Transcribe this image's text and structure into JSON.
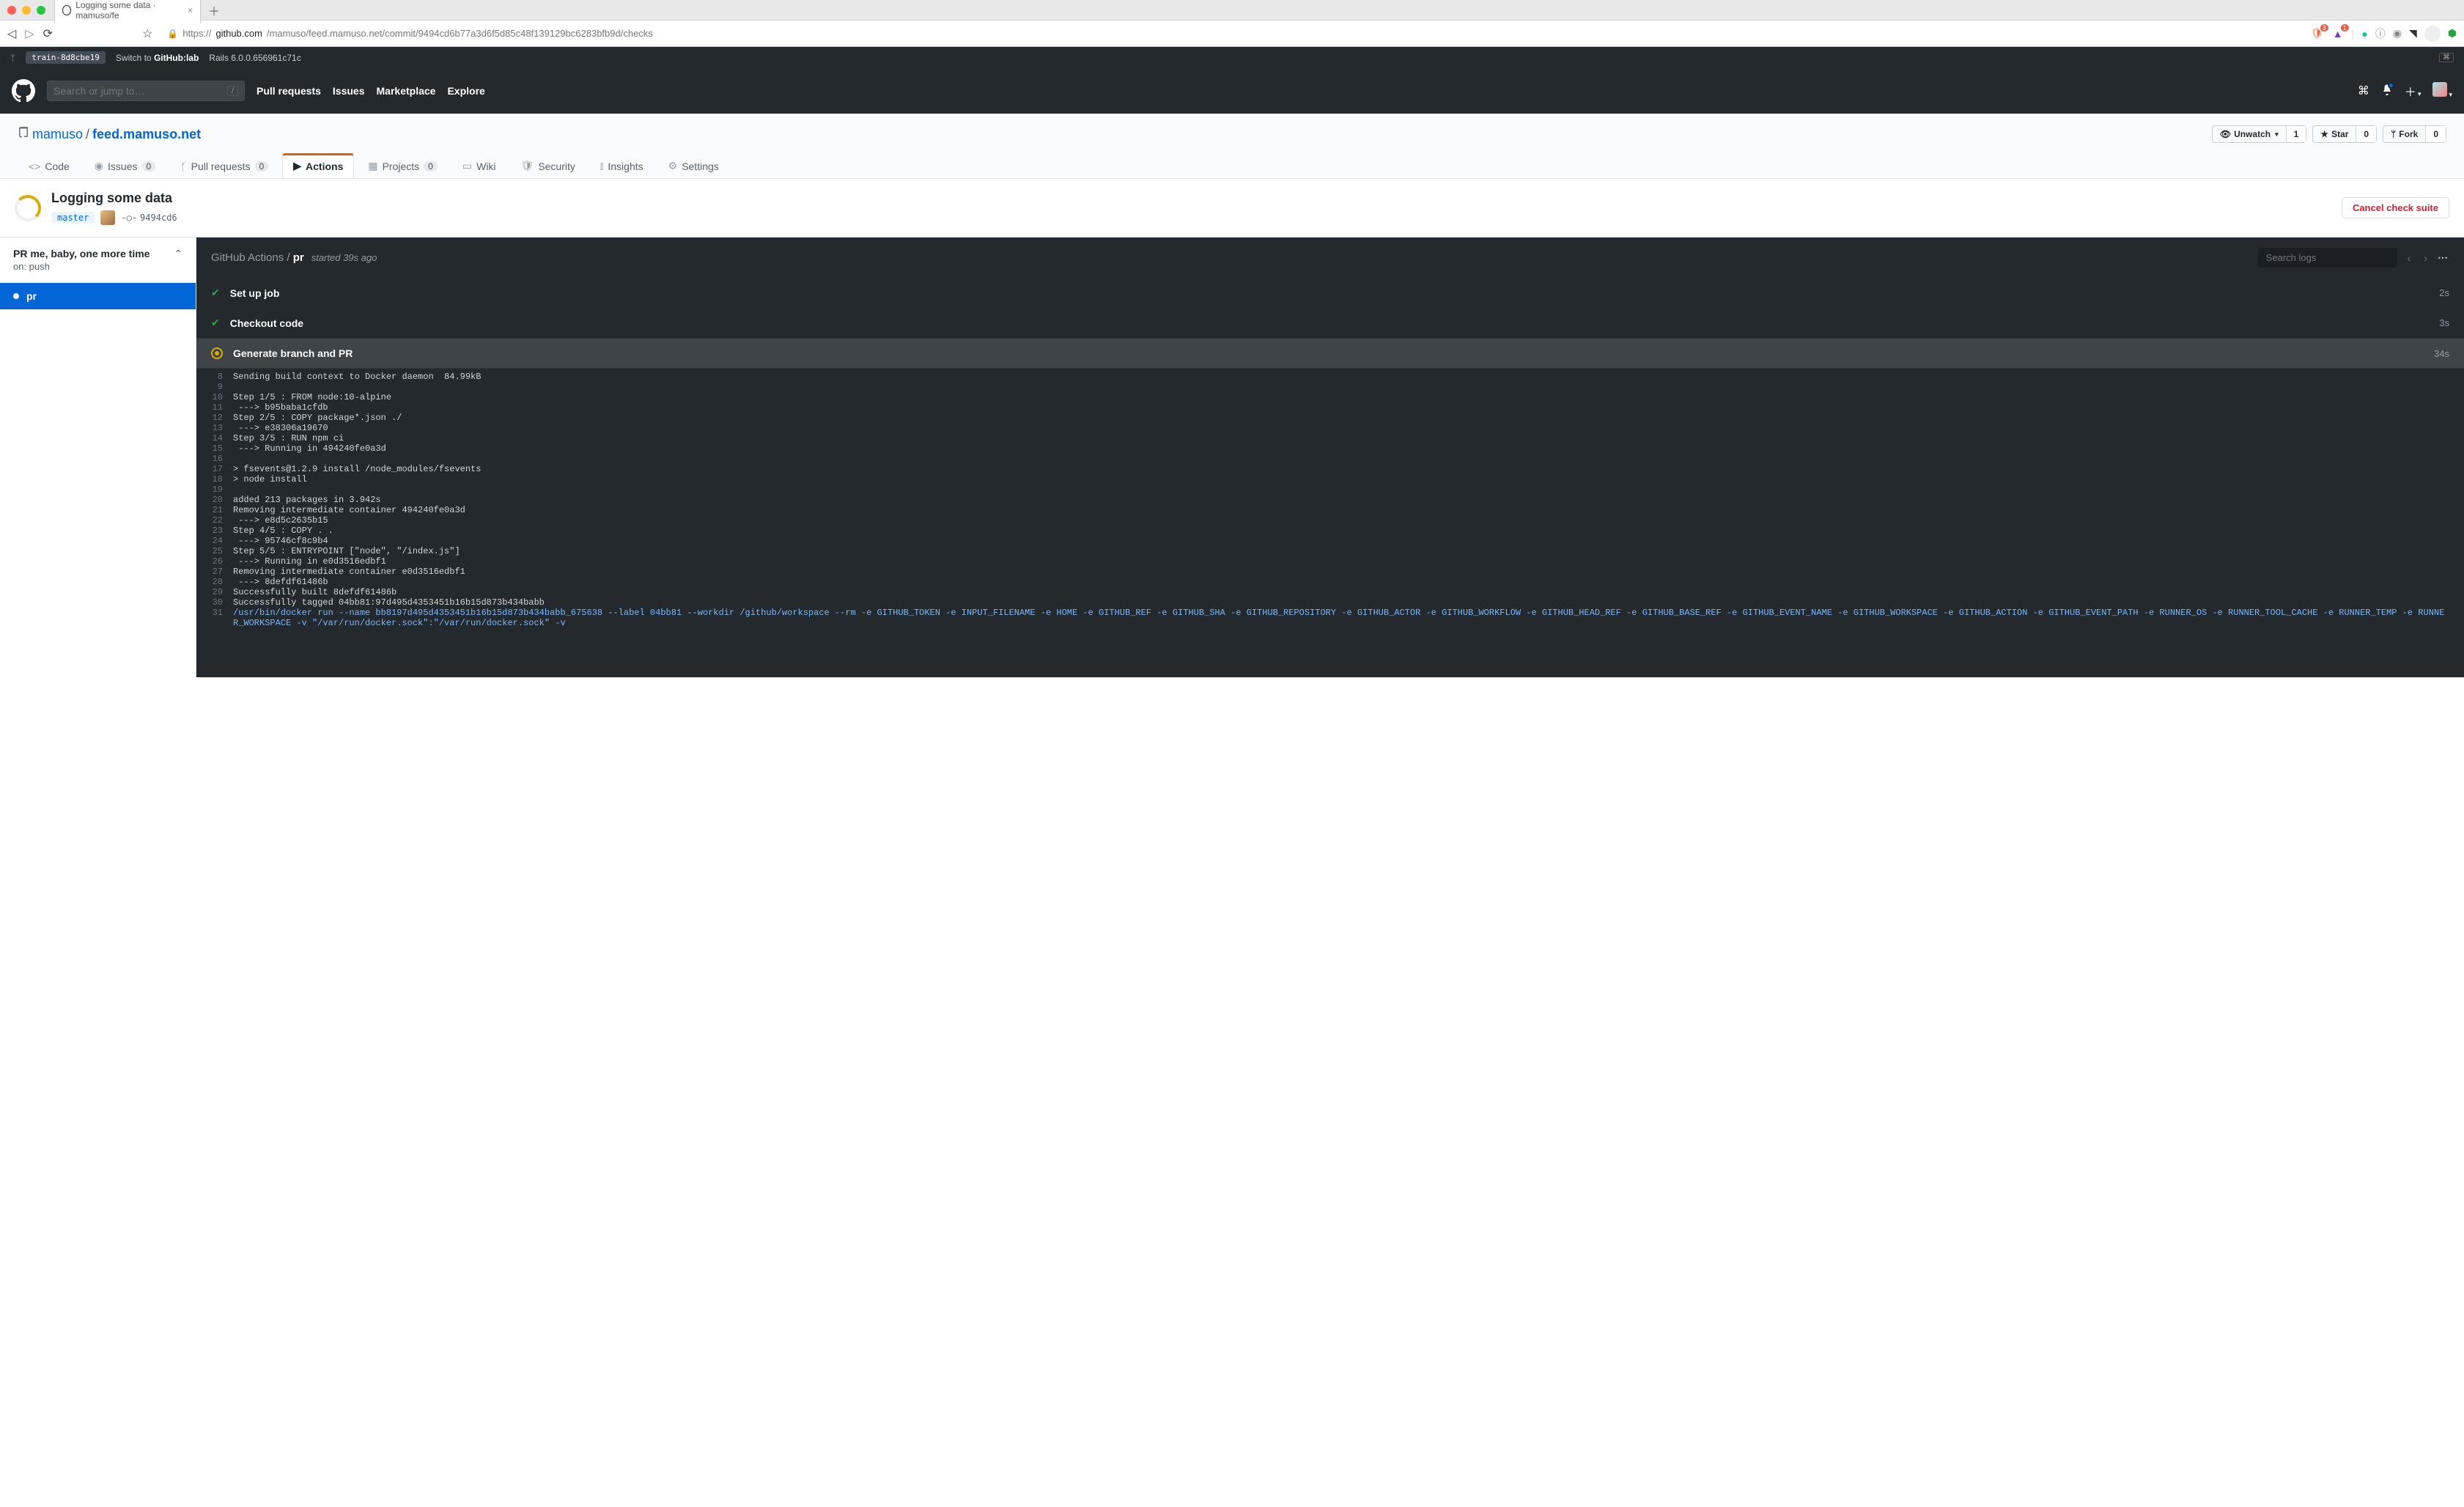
{
  "browser": {
    "tab_title": "Logging some data · mamuso/fe",
    "url_proto": "https://",
    "url_host": "github.com",
    "url_path": "/mamuso/feed.mamuso.net/commit/9494cd6b77a3d6f5d85c48f139129bc6283bfb9d/checks",
    "ext_badge1": "3",
    "ext_badge2": "1"
  },
  "devstrip": {
    "branch": "train-8d8cbe19",
    "switch_prefix": "Switch to ",
    "switch_target": "GitHub:lab",
    "rails": "Rails 6.0.0.656961c71c"
  },
  "gh_header": {
    "search_placeholder": "Search or jump to…",
    "slash": "/",
    "nav": {
      "pulls": "Pull requests",
      "issues": "Issues",
      "marketplace": "Marketplace",
      "explore": "Explore"
    }
  },
  "repo": {
    "owner": "mamuso",
    "name": "feed.mamuso.net",
    "sep": "/",
    "actions": {
      "unwatch": "Unwatch",
      "unwatch_count": "1",
      "star": "Star",
      "star_count": "0",
      "fork": "Fork",
      "fork_count": "0"
    },
    "nav": {
      "code": "Code",
      "issues": "Issues",
      "issues_count": "0",
      "pulls": "Pull requests",
      "pulls_count": "0",
      "actions": "Actions",
      "projects": "Projects",
      "projects_count": "0",
      "wiki": "Wiki",
      "security": "Security",
      "insights": "Insights",
      "settings": "Settings"
    }
  },
  "checks": {
    "title": "Logging some data",
    "branch": "master",
    "sha": "9494cd6",
    "cancel": "Cancel check suite",
    "workflow": "PR me, baby, one more time",
    "on_label": "on: push",
    "job_name": "pr",
    "crumb_prefix": "GitHub Actions / ",
    "crumb_job": "pr",
    "started": "started 39s ago",
    "search_placeholder": "Search logs"
  },
  "steps": {
    "s1": {
      "name": "Set up job",
      "dur": "2s"
    },
    "s2": {
      "name": "Checkout code",
      "dur": "3s"
    },
    "s3": {
      "name": "Generate branch and PR",
      "dur": "34s"
    }
  },
  "log": {
    "l8": {
      "n": "8",
      "t": "Sending build context to Docker daemon  84.99kB"
    },
    "l9": {
      "n": "9",
      "t": ""
    },
    "l10": {
      "n": "10",
      "t": "Step 1/5 : FROM node:10-alpine"
    },
    "l11": {
      "n": "11",
      "t": " ---> b95baba1cfdb"
    },
    "l12": {
      "n": "12",
      "t": "Step 2/5 : COPY package*.json ./"
    },
    "l13": {
      "n": "13",
      "t": " ---> e38306a19670"
    },
    "l14": {
      "n": "14",
      "t": "Step 3/5 : RUN npm ci"
    },
    "l15": {
      "n": "15",
      "t": " ---> Running in 494240fe0a3d"
    },
    "l16": {
      "n": "16",
      "t": ""
    },
    "l17": {
      "n": "17",
      "t": "> fsevents@1.2.9 install /node_modules/fsevents"
    },
    "l18": {
      "n": "18",
      "t": "> node install"
    },
    "l19": {
      "n": "19",
      "t": ""
    },
    "l20": {
      "n": "20",
      "t": "added 213 packages in 3.942s"
    },
    "l21": {
      "n": "21",
      "t": "Removing intermediate container 494240fe0a3d"
    },
    "l22": {
      "n": "22",
      "t": " ---> e8d5c2635b15"
    },
    "l23": {
      "n": "23",
      "t": "Step 4/5 : COPY . ."
    },
    "l24": {
      "n": "24",
      "t": " ---> 95746cf8c9b4"
    },
    "l25": {
      "n": "25",
      "t": "Step 5/5 : ENTRYPOINT [\"node\", \"/index.js\"]"
    },
    "l26": {
      "n": "26",
      "t": " ---> Running in e0d3516edbf1"
    },
    "l27": {
      "n": "27",
      "t": "Removing intermediate container e0d3516edbf1"
    },
    "l28": {
      "n": "28",
      "t": " ---> 8defdf61486b"
    },
    "l29": {
      "n": "29",
      "t": "Successfully built 8defdf61486b"
    },
    "l30": {
      "n": "30",
      "t": "Successfully tagged 04bb81:97d495d4353451b16b15d873b434babb"
    },
    "l31": {
      "n": "31",
      "t": "/usr/bin/docker run --name bb8197d495d4353451b16b15d873b434babb_675638 --label 04bb81 --workdir /github/workspace --rm -e GITHUB_TOKEN -e INPUT_FILENAME -e HOME -e GITHUB_REF -e GITHUB_SHA -e GITHUB_REPOSITORY -e GITHUB_ACTOR -e GITHUB_WORKFLOW -e GITHUB_HEAD_REF -e GITHUB_BASE_REF -e GITHUB_EVENT_NAME -e GITHUB_WORKSPACE -e GITHUB_ACTION -e GITHUB_EVENT_PATH -e RUNNER_OS -e RUNNER_TOOL_CACHE -e RUNNER_TEMP -e RUNNER_WORKSPACE -v \"/var/run/docker.sock\":\"/var/run/docker.sock\" -v"
    }
  }
}
